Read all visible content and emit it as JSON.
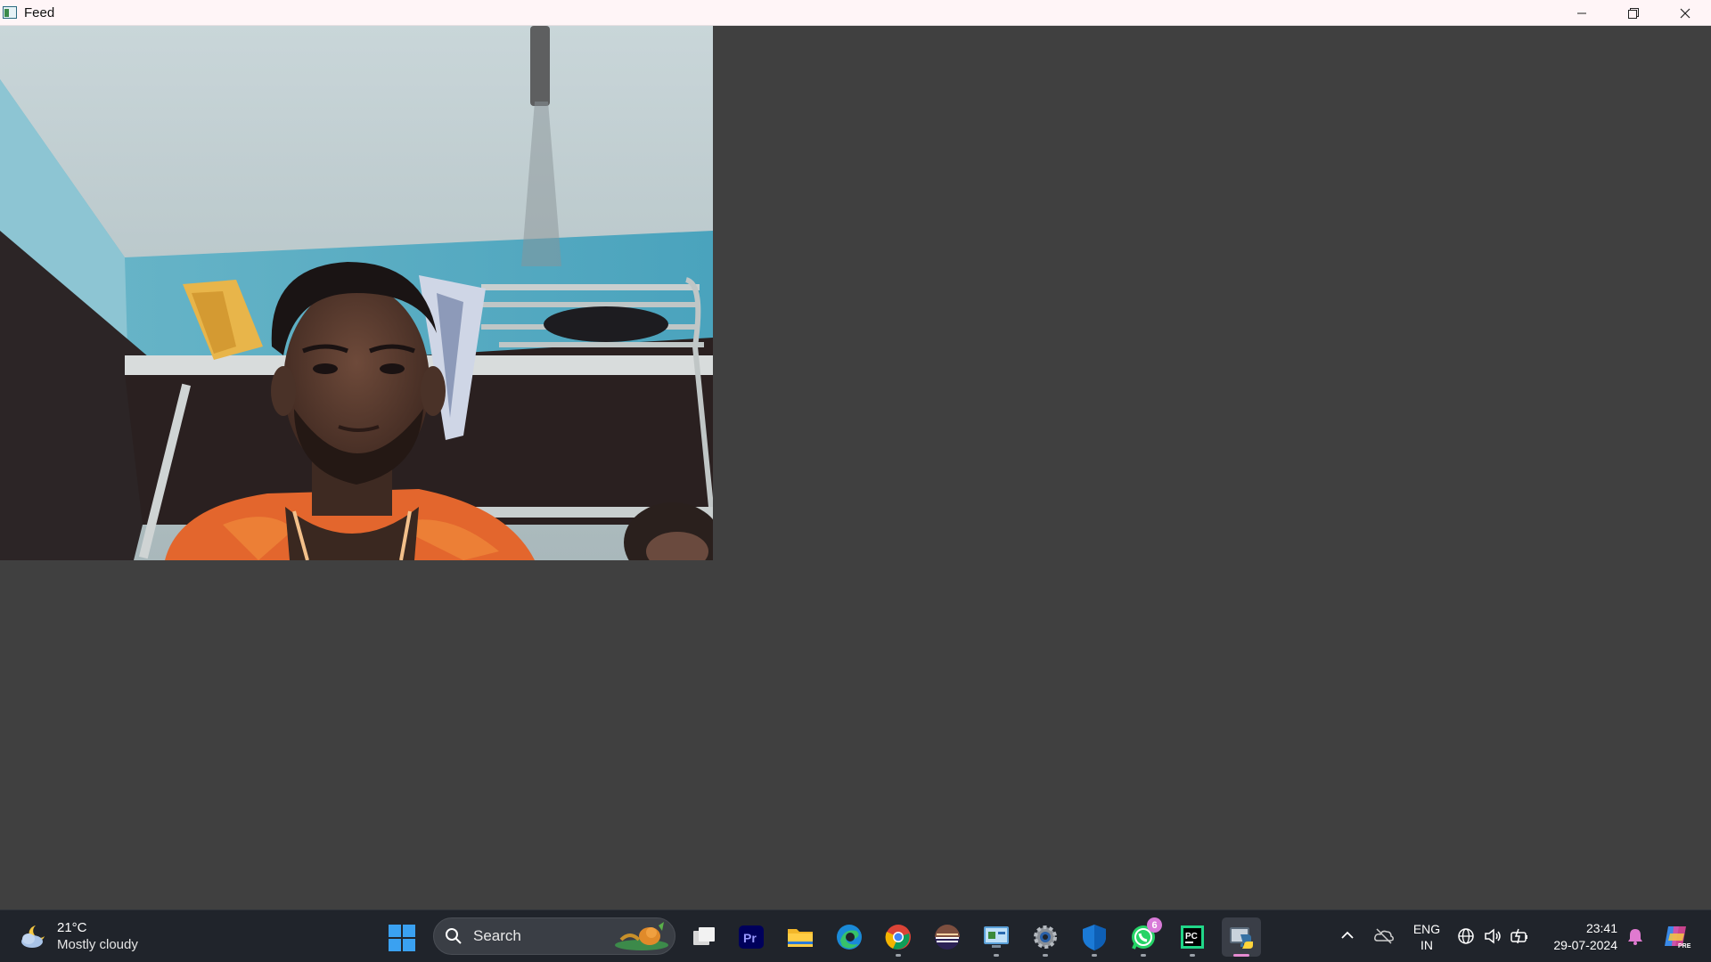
{
  "window": {
    "title": "Feed",
    "app_icon": "app-window-icon",
    "controls": [
      "minimize-icon",
      "restore-icon",
      "close-icon"
    ]
  },
  "feed": {
    "description_icon": "camera-feed-image"
  },
  "taskbar": {
    "weather": {
      "temperature": "21°C",
      "condition": "Mostly cloudy",
      "icon": "partly-cloudy-night-icon"
    },
    "search": {
      "placeholder": "Search"
    },
    "apps": [
      {
        "name": "task-view",
        "icon": "task-view-icon",
        "running": false
      },
      {
        "name": "premiere-pro",
        "icon": "premiere-pro-icon",
        "label": "Pr",
        "running": false
      },
      {
        "name": "file-explorer",
        "icon": "folder-icon",
        "running": false
      },
      {
        "name": "edge",
        "icon": "edge-icon",
        "running": false
      },
      {
        "name": "chrome",
        "icon": "chrome-icon",
        "running": true
      },
      {
        "name": "eclipse",
        "icon": "eclipse-icon",
        "running": false
      },
      {
        "name": "control-panel",
        "icon": "control-panel-icon",
        "running": true
      },
      {
        "name": "settings",
        "icon": "gear-icon",
        "running": true
      },
      {
        "name": "defender",
        "icon": "shield-icon",
        "running": true
      },
      {
        "name": "whatsapp",
        "icon": "whatsapp-icon",
        "running": true,
        "badge": "6"
      },
      {
        "name": "pycharm",
        "icon": "pycharm-icon",
        "label": "PC",
        "running": true
      },
      {
        "name": "python",
        "icon": "python-icon",
        "running": true,
        "active": true
      }
    ],
    "tray": {
      "language_line1": "ENG",
      "language_line2": "IN",
      "time": "23:41",
      "date": "29-07-2024"
    }
  },
  "colors": {
    "client_background": "#404040",
    "taskbar_background": "#20242b",
    "titlebar_background": "#fff5f7",
    "accent": "#3aa1f1"
  }
}
